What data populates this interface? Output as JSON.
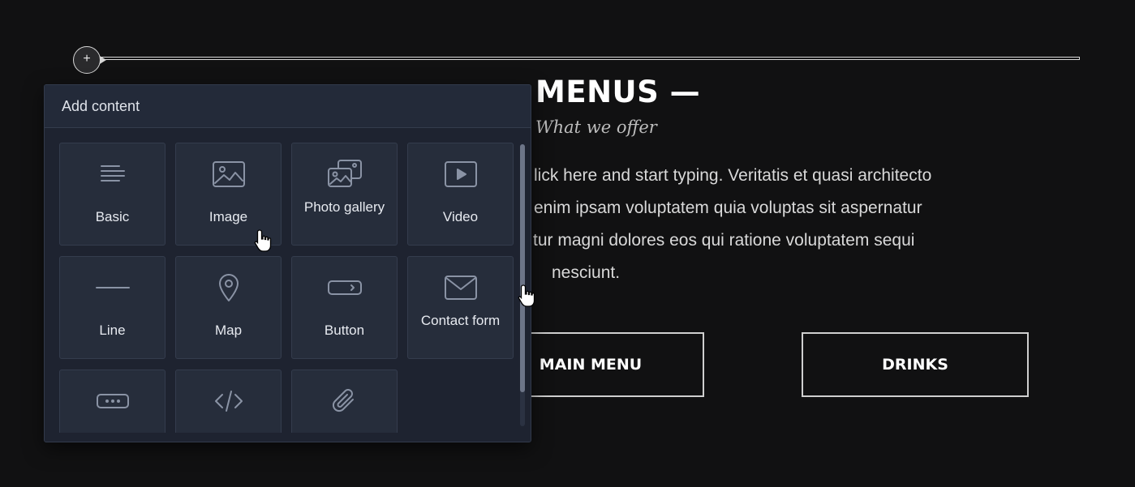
{
  "page": {
    "heading": "MENUS —",
    "subtitle": "What we offer",
    "body_lines": [
      "lick here and start typing. Veritatis et quasi architecto",
      "enim ipsam voluptatem quia voluptas sit aspernatur",
      "tur magni dolores eos qui ratione voluptatem sequi",
      "nesciunt."
    ],
    "buttons": {
      "main_menu": "MAIN MENU",
      "drinks": "DRINKS"
    },
    "add_section_symbol": "+"
  },
  "panel": {
    "title": "Add content",
    "tiles": [
      {
        "label": "Basic",
        "icon": "text-lines-icon"
      },
      {
        "label": "Image",
        "icon": "image-icon"
      },
      {
        "label": "Photo gallery",
        "icon": "photo-gallery-icon"
      },
      {
        "label": "Video",
        "icon": "video-icon"
      },
      {
        "label": "Line",
        "icon": "line-icon"
      },
      {
        "label": "Map",
        "icon": "map-pin-icon"
      },
      {
        "label": "Button",
        "icon": "button-icon"
      },
      {
        "label": "Contact form",
        "icon": "envelope-icon"
      },
      {
        "label": "",
        "icon": "input-field-icon"
      },
      {
        "label": "",
        "icon": "code-icon"
      },
      {
        "label": "",
        "icon": "paperclip-icon"
      }
    ]
  },
  "colors": {
    "background": "#111112",
    "panel": "#1e2330",
    "tile": "#262d3b",
    "icon": "#8a93a5",
    "text": "#e7eaf0"
  }
}
